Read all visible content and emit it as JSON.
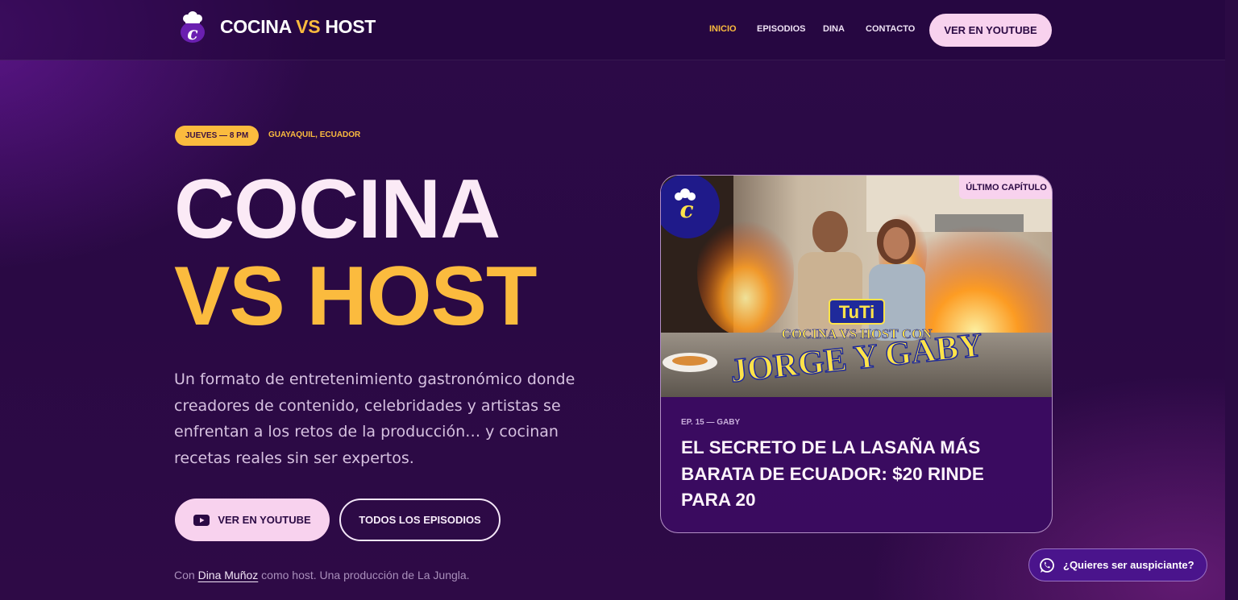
{
  "header": {
    "brand_part1": "COCINA",
    "brand_part2": "VS",
    "brand_part3": "HOST",
    "nav": [
      {
        "label": "INICIO",
        "active": true
      },
      {
        "label": "EPISODIOS",
        "active": false
      },
      {
        "label": "DINA",
        "active": false
      },
      {
        "label": "CONTACTO",
        "active": false
      }
    ],
    "cta": "VER EN YOUTUBE"
  },
  "hero": {
    "schedule": "JUEVES — 8 PM",
    "location": "GUAYAQUIL, ECUADOR",
    "title_line1": "COCINA",
    "title_line2": "VS HOST",
    "description": "Un formato de entretenimiento gastronómico donde creadores de contenido, celebridades y artistas se enfrentan a los retos de la producción… y cocinan recetas reales sin ser expertos.",
    "primary_button": "VER EN YOUTUBE",
    "secondary_button": "TODOS LOS EPISODIOS",
    "credit_prefix": "Con",
    "credit_host": "Dina Muñoz",
    "credit_suffix": "como host. Una producción de La Jungla."
  },
  "latest_episode": {
    "badge": "ÚLTIMO CAPÍTULO",
    "thumbnail_brand": "TuTi",
    "thumbnail_subtitle": "COCINA VS HOST CON",
    "thumbnail_title": "JORGE Y GABY",
    "meta": "EP. 15 — GABY",
    "title": "EL SECRETO DE LA LASAÑA MÁS BARATA DE ECUADOR: $20 RINDE PARA 20"
  },
  "floating": {
    "whatsapp_label": "¿Quieres ser auspiciante?"
  },
  "colors": {
    "accent": "#fbbb3e",
    "pink": "#f8d2ee",
    "background": "#2a0944",
    "card": "#3b0b63"
  }
}
